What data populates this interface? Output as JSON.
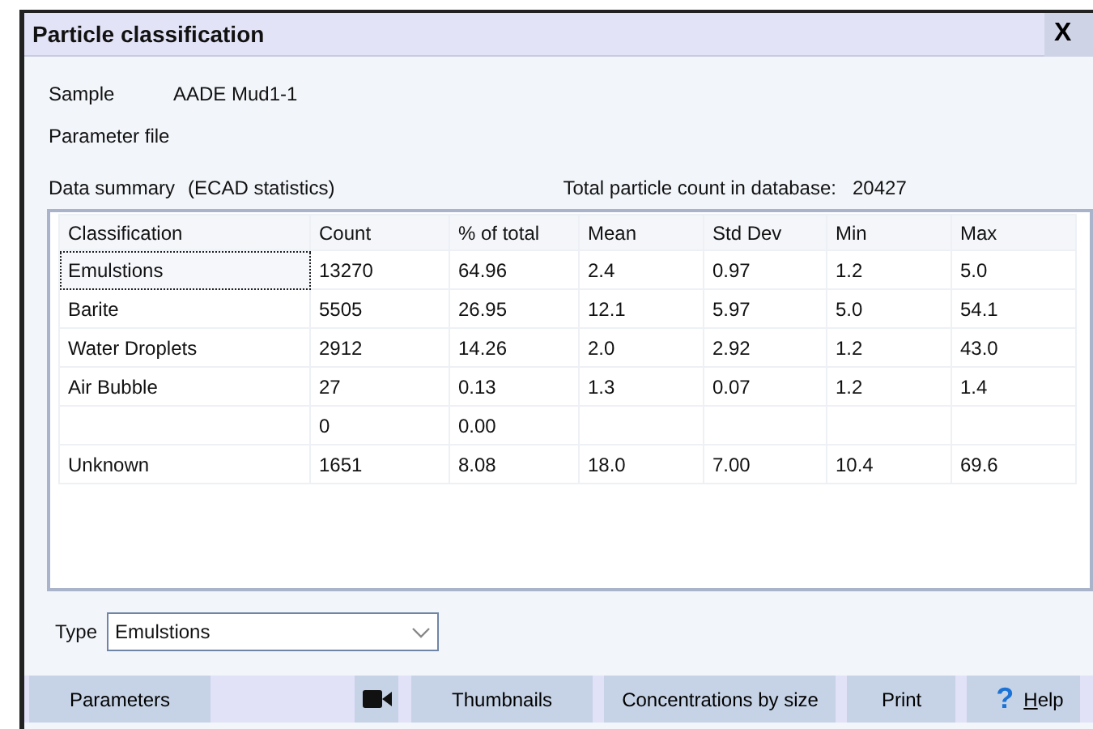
{
  "window": {
    "title": "Particle classification",
    "close": "X"
  },
  "sample": {
    "label": "Sample",
    "value": "AADE Mud1-1"
  },
  "parameter_file": {
    "label": "Parameter file"
  },
  "summary": {
    "label": "Data summary",
    "source": "(ECAD statistics)",
    "total_label": "Total particle count in database:",
    "total": "20427"
  },
  "table": {
    "columns": [
      "Classification",
      "Count",
      "% of total",
      "Mean",
      "Std Dev",
      "Min",
      "Max"
    ],
    "rows": [
      {
        "cells": [
          "Emulstions",
          "13270",
          "64.96",
          "2.4",
          "0.97",
          "1.2",
          "5.0"
        ],
        "focused": true
      },
      {
        "cells": [
          "Barite",
          "5505",
          "26.95",
          "12.1",
          "5.97",
          "5.0",
          "54.1"
        ],
        "focused": false
      },
      {
        "cells": [
          "Water Droplets",
          "2912",
          "14.26",
          "2.0",
          "2.92",
          "1.2",
          "43.0"
        ],
        "focused": false
      },
      {
        "cells": [
          "Air Bubble",
          "27",
          "0.13",
          "1.3",
          "0.07",
          "1.2",
          "1.4"
        ],
        "focused": false
      },
      {
        "cells": [
          "",
          "0",
          "0.00",
          "",
          "",
          "",
          ""
        ],
        "focused": false
      },
      {
        "cells": [
          "Unknown",
          "1651",
          "8.08",
          "18.0",
          "7.00",
          "10.4",
          "69.6"
        ],
        "focused": false
      }
    ]
  },
  "type": {
    "label": "Type",
    "value": "Emulstions"
  },
  "buttons": [
    {
      "kind": "text",
      "label": "Parameters"
    },
    {
      "kind": "spacer"
    },
    {
      "kind": "icon"
    },
    {
      "kind": "text",
      "label": "Thumbnails"
    },
    {
      "kind": "text",
      "label": "Concentrations by size"
    },
    {
      "kind": "text",
      "label": "Print"
    },
    {
      "kind": "help",
      "icon": "?",
      "label": "Help"
    }
  ]
}
